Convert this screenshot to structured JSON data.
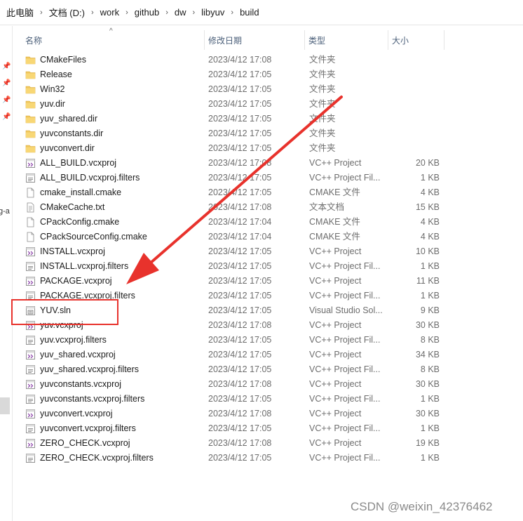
{
  "breadcrumb": [
    "此电脑",
    "文档 (D:)",
    "work",
    "github",
    "dw",
    "libyuv",
    "build"
  ],
  "columns": {
    "name": "名称",
    "date": "修改日期",
    "type": "类型",
    "size": "大小"
  },
  "nav_fragment": "g-a",
  "files": [
    {
      "name": "CMakeFiles",
      "date": "2023/4/12 17:08",
      "type": "文件夹",
      "size": "",
      "icon": "folder-icon"
    },
    {
      "name": "Release",
      "date": "2023/4/12 17:05",
      "type": "文件夹",
      "size": "",
      "icon": "folder-icon"
    },
    {
      "name": "Win32",
      "date": "2023/4/12 17:05",
      "type": "文件夹",
      "size": "",
      "icon": "folder-icon"
    },
    {
      "name": "yuv.dir",
      "date": "2023/4/12 17:05",
      "type": "文件夹",
      "size": "",
      "icon": "folder-icon"
    },
    {
      "name": "yuv_shared.dir",
      "date": "2023/4/12 17:05",
      "type": "文件夹",
      "size": "",
      "icon": "folder-icon"
    },
    {
      "name": "yuvconstants.dir",
      "date": "2023/4/12 17:05",
      "type": "文件夹",
      "size": "",
      "icon": "folder-icon"
    },
    {
      "name": "yuvconvert.dir",
      "date": "2023/4/12 17:05",
      "type": "文件夹",
      "size": "",
      "icon": "folder-icon"
    },
    {
      "name": "ALL_BUILD.vcxproj",
      "date": "2023/4/12 17:08",
      "type": "VC++ Project",
      "size": "20 KB",
      "icon": "vcxproj-icon"
    },
    {
      "name": "ALL_BUILD.vcxproj.filters",
      "date": "2023/4/12 17:05",
      "type": "VC++ Project Fil...",
      "size": "1 KB",
      "icon": "filters-icon"
    },
    {
      "name": "cmake_install.cmake",
      "date": "2023/4/12 17:05",
      "type": "CMAKE 文件",
      "size": "4 KB",
      "icon": "file-icon"
    },
    {
      "name": "CMakeCache.txt",
      "date": "2023/4/12 17:08",
      "type": "文本文档",
      "size": "15 KB",
      "icon": "text-file-icon"
    },
    {
      "name": "CPackConfig.cmake",
      "date": "2023/4/12 17:04",
      "type": "CMAKE 文件",
      "size": "4 KB",
      "icon": "file-icon"
    },
    {
      "name": "CPackSourceConfig.cmake",
      "date": "2023/4/12 17:04",
      "type": "CMAKE 文件",
      "size": "4 KB",
      "icon": "file-icon"
    },
    {
      "name": "INSTALL.vcxproj",
      "date": "2023/4/12 17:05",
      "type": "VC++ Project",
      "size": "10 KB",
      "icon": "vcxproj-icon"
    },
    {
      "name": "INSTALL.vcxproj.filters",
      "date": "2023/4/12 17:05",
      "type": "VC++ Project Fil...",
      "size": "1 KB",
      "icon": "filters-icon"
    },
    {
      "name": "PACKAGE.vcxproj",
      "date": "2023/4/12 17:05",
      "type": "VC++ Project",
      "size": "11 KB",
      "icon": "vcxproj-icon"
    },
    {
      "name": "PACKAGE.vcxproj.filters",
      "date": "2023/4/12 17:05",
      "type": "VC++ Project Fil...",
      "size": "1 KB",
      "icon": "filters-icon"
    },
    {
      "name": "YUV.sln",
      "date": "2023/4/12 17:05",
      "type": "Visual Studio Sol...",
      "size": "9 KB",
      "icon": "sln-icon"
    },
    {
      "name": "yuv.vcxproj",
      "date": "2023/4/12 17:08",
      "type": "VC++ Project",
      "size": "30 KB",
      "icon": "vcxproj-icon"
    },
    {
      "name": "yuv.vcxproj.filters",
      "date": "2023/4/12 17:05",
      "type": "VC++ Project Fil...",
      "size": "8 KB",
      "icon": "filters-icon"
    },
    {
      "name": "yuv_shared.vcxproj",
      "date": "2023/4/12 17:05",
      "type": "VC++ Project",
      "size": "34 KB",
      "icon": "vcxproj-icon"
    },
    {
      "name": "yuv_shared.vcxproj.filters",
      "date": "2023/4/12 17:05",
      "type": "VC++ Project Fil...",
      "size": "8 KB",
      "icon": "filters-icon"
    },
    {
      "name": "yuvconstants.vcxproj",
      "date": "2023/4/12 17:08",
      "type": "VC++ Project",
      "size": "30 KB",
      "icon": "vcxproj-icon"
    },
    {
      "name": "yuvconstants.vcxproj.filters",
      "date": "2023/4/12 17:05",
      "type": "VC++ Project Fil...",
      "size": "1 KB",
      "icon": "filters-icon"
    },
    {
      "name": "yuvconvert.vcxproj",
      "date": "2023/4/12 17:08",
      "type": "VC++ Project",
      "size": "30 KB",
      "icon": "vcxproj-icon"
    },
    {
      "name": "yuvconvert.vcxproj.filters",
      "date": "2023/4/12 17:05",
      "type": "VC++ Project Fil...",
      "size": "1 KB",
      "icon": "filters-icon"
    },
    {
      "name": "ZERO_CHECK.vcxproj",
      "date": "2023/4/12 17:08",
      "type": "VC++ Project",
      "size": "19 KB",
      "icon": "vcxproj-icon"
    },
    {
      "name": "ZERO_CHECK.vcxproj.filters",
      "date": "2023/4/12 17:05",
      "type": "VC++ Project Fil...",
      "size": "1 KB",
      "icon": "filters-icon"
    }
  ],
  "annotation": {
    "color": "#e8322c",
    "highlighted_file": "YUV.sln"
  },
  "watermark": "CSDN @weixin_42376462"
}
